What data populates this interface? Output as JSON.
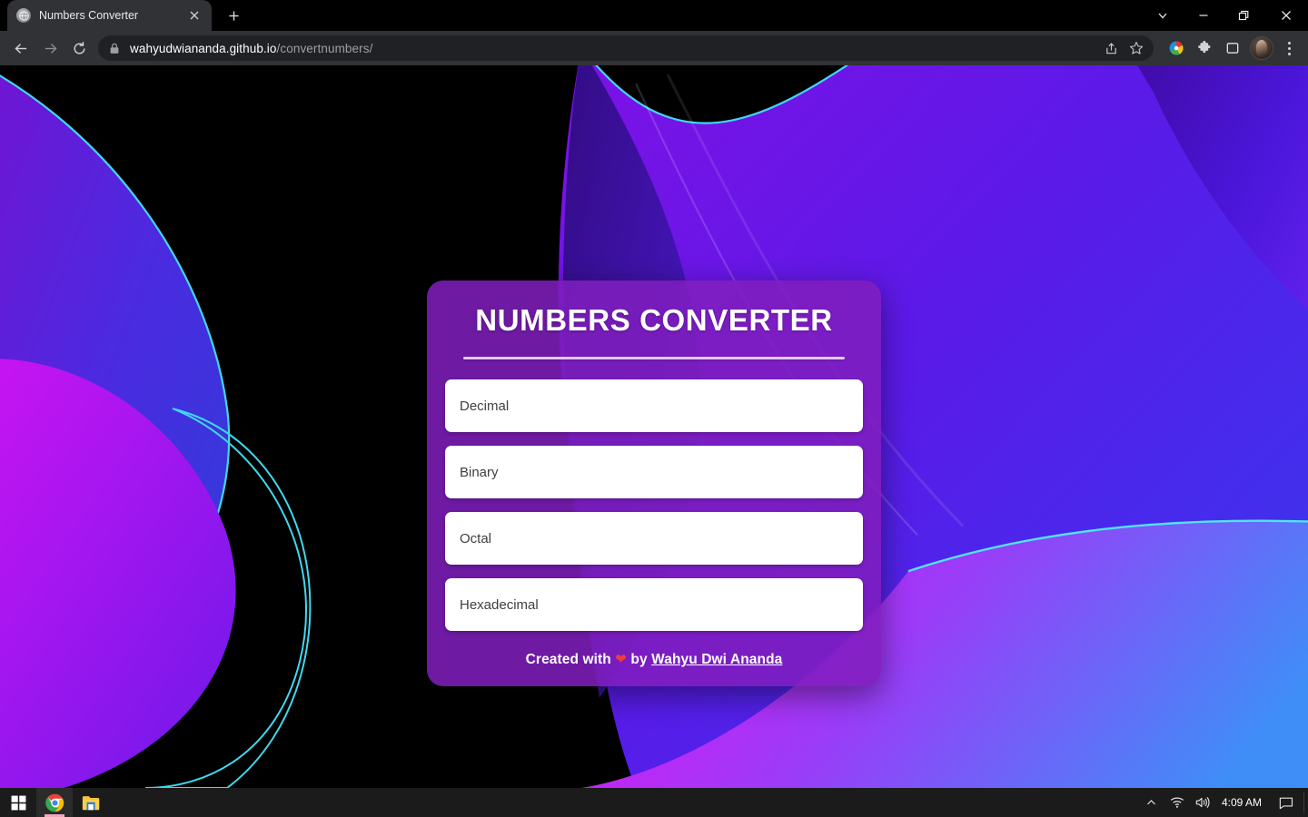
{
  "browser": {
    "tab": {
      "title": "Numbers Converter",
      "favicon_icon": "globe-icon",
      "close_icon": "close-icon"
    },
    "new_tab_label": "+",
    "window_controls": [
      {
        "name": "tab-search",
        "icon": "chevron-down-icon"
      },
      {
        "name": "minimize",
        "icon": "minimize-icon"
      },
      {
        "name": "maximize",
        "icon": "restore-icon"
      },
      {
        "name": "close",
        "icon": "close-icon"
      }
    ],
    "toolbar": {
      "back_icon": "back-arrow-icon",
      "forward_icon": "forward-arrow-icon",
      "reload_icon": "reload-icon",
      "lock_icon": "lock-icon",
      "url_host": "wahyudwiananda.github.io",
      "url_path": "/convertnumbers/",
      "url_full": "wahyudwiananda.github.io/convertnumbers/",
      "share_icon": "share-icon",
      "bookmark_icon": "star-icon",
      "download_manager_icon": "idm-download-icon",
      "extensions_icon": "puzzle-piece-icon",
      "side_panel_icon": "side-panel-icon",
      "profile_icon": "avatar-icon",
      "menu_icon": "three-dot-menu-icon"
    }
  },
  "page": {
    "title": "NUMBERS CONVERTER",
    "fields": [
      {
        "name": "decimal",
        "placeholder": "Decimal",
        "value": ""
      },
      {
        "name": "binary",
        "placeholder": "Binary",
        "value": ""
      },
      {
        "name": "octal",
        "placeholder": "Octal",
        "value": ""
      },
      {
        "name": "hexadecimal",
        "placeholder": "Hexadecimal",
        "value": ""
      }
    ],
    "footer": {
      "prefix": "Created with",
      "heart": "❤",
      "middle": "by",
      "author": "Wahyu Dwi Ananda"
    },
    "colors": {
      "card_purple": "#801ebe",
      "card_title": "#ffffff",
      "divider": "#e9d8f7",
      "heart_red": "#ef3d3d",
      "field_bg": "#ffffff",
      "field_text": "#3f3f3f",
      "wallpaper_black": "#000000",
      "wallpaper_violet": "#6a0bd8",
      "wallpaper_magenta": "#c816f0",
      "wallpaper_blue": "#3d5ae8",
      "wallpaper_cyan_edge": "#3fd8f0"
    }
  },
  "taskbar": {
    "start_icon": "windows-start-icon",
    "apps": [
      {
        "name": "chrome",
        "icon": "chrome-icon",
        "active": true
      },
      {
        "name": "file-explorer",
        "icon": "folder-icon",
        "active": false
      }
    ],
    "tray": {
      "overflow_icon": "chevron-up-icon",
      "network_icon": "wifi-icon",
      "volume_icon": "speaker-icon",
      "clock": "4:09 AM",
      "action_center_icon": "notification-icon"
    }
  }
}
